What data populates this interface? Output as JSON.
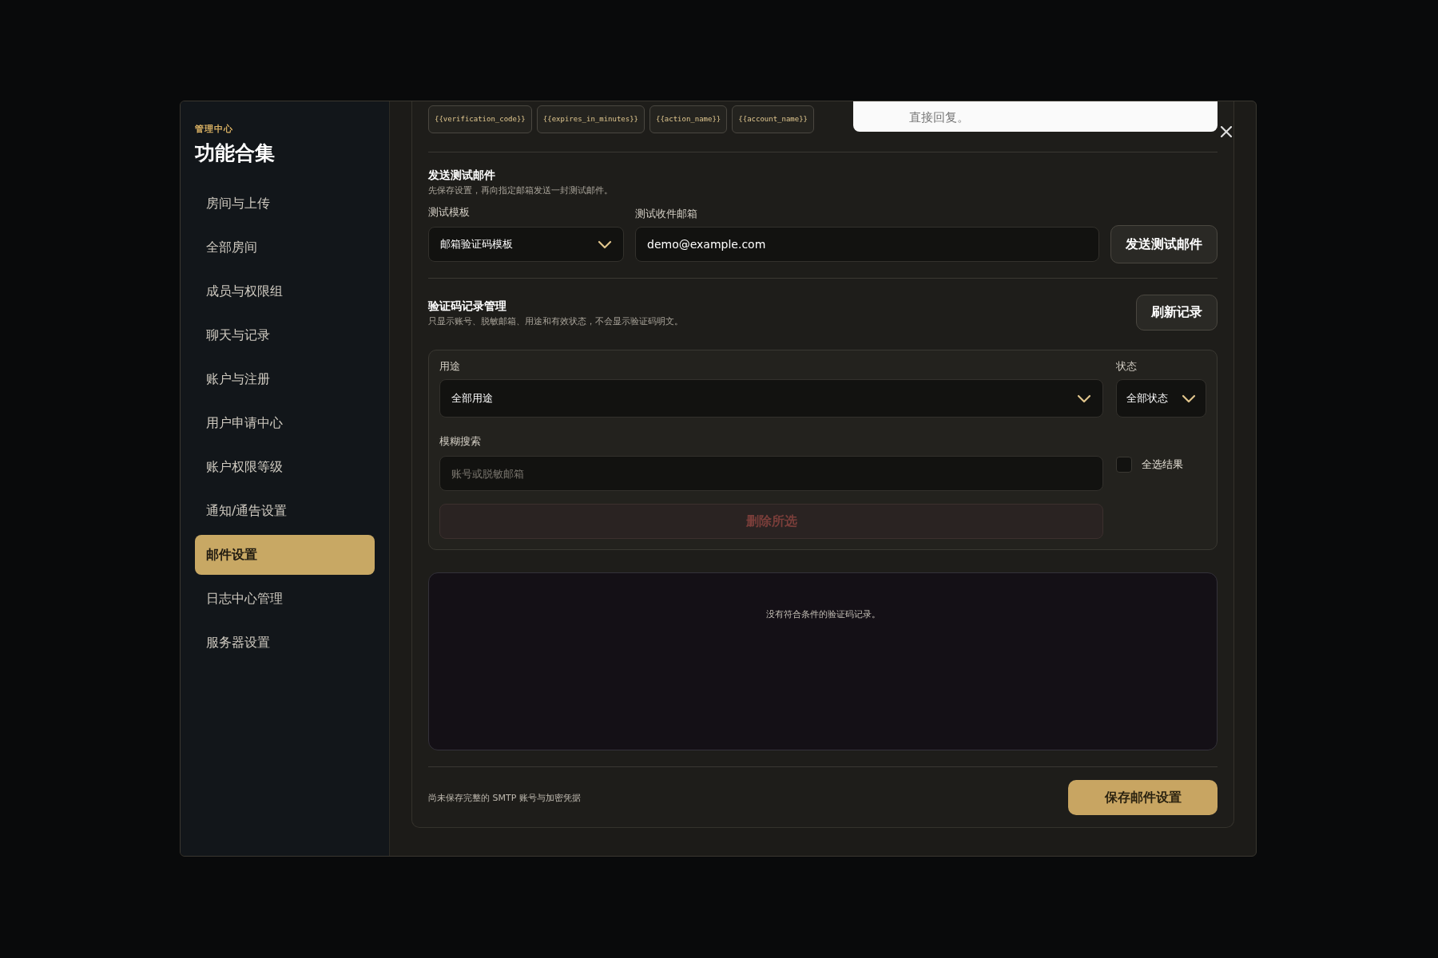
{
  "sidebar": {
    "eyebrow": "管理中心",
    "title": "功能合集",
    "items": [
      {
        "label": "房间与上传",
        "selected": false
      },
      {
        "label": "全部房间",
        "selected": false
      },
      {
        "label": "成员与权限组",
        "selected": false
      },
      {
        "label": "聊天与记录",
        "selected": false
      },
      {
        "label": "账户与注册",
        "selected": false
      },
      {
        "label": "用户申请中心",
        "selected": false
      },
      {
        "label": "账户权限等级",
        "selected": false
      },
      {
        "label": "通知/通告设置",
        "selected": false
      },
      {
        "label": "邮件设置",
        "selected": true
      },
      {
        "label": "日志中心管理",
        "selected": false
      },
      {
        "label": "服务器设置",
        "selected": false
      }
    ]
  },
  "variables": [
    "{{verification_code}}",
    "{{expires_in_minutes}}",
    "{{action_name}}",
    "{{account_name}}"
  ],
  "notice": {
    "text": "直接回复。"
  },
  "test_email": {
    "title": "发送测试邮件",
    "description": "先保存设置，再向指定邮箱发送一封测试邮件。",
    "template_label": "测试模板",
    "template_value": "邮箱验证码模板",
    "recipient_label": "测试收件邮箱",
    "recipient_value": "demo@example.com",
    "send_button": "发送测试邮件"
  },
  "records": {
    "title": "验证码记录管理",
    "description": "只显示账号、脱敏邮箱、用途和有效状态，不会显示验证码明文。",
    "refresh_button": "刷新记录",
    "purpose_label": "用途",
    "purpose_value": "全部用途",
    "status_label": "状态",
    "status_value": "全部状态",
    "search_label": "模糊搜索",
    "search_placeholder": "账号或脱敏邮箱",
    "select_all": {
      "label": "全选结果",
      "checked": false
    },
    "delete_button": {
      "label": "删除所选",
      "disabled": true
    },
    "empty_text": "没有符合条件的验证码记录。"
  },
  "footer": {
    "status_text": "尚未保存完整的 SMTP 账号与加密凭据",
    "save_button": "保存邮件设置"
  }
}
